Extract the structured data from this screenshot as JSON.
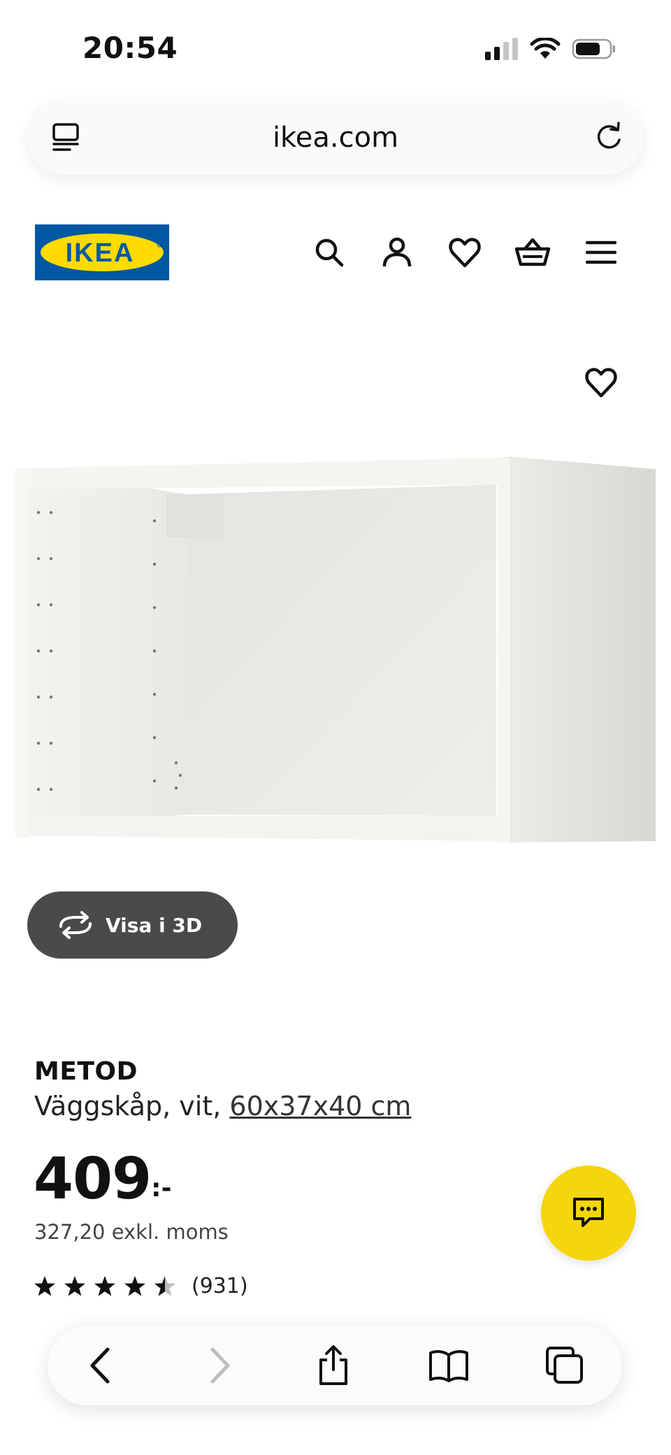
{
  "status_bar": {
    "time": "20:54",
    "icons": [
      "cellular-signal-icon",
      "wifi-icon",
      "battery-icon"
    ]
  },
  "browser": {
    "url": "ikea.com",
    "icons": [
      "reader-icon",
      "reload-icon"
    ]
  },
  "header": {
    "logo_text": "IKEA",
    "icons": [
      "search-icon",
      "account-icon",
      "heart-icon",
      "shopping-basket-icon",
      "menu-icon"
    ]
  },
  "product": {
    "view_3d_label": "Visa i 3D",
    "name": "METOD",
    "description_prefix": "Väggskåp, vit, ",
    "size": "60x37x40 cm",
    "price": "409",
    "price_suffix": ":-",
    "price_excl_vat": "327,20 exkl. moms",
    "rating_value": 4.5,
    "rating_max": 5,
    "review_count": "(931)"
  },
  "colors": {
    "ikea_blue": "#0058a3",
    "ikea_yellow": "#ffdb00",
    "chat_button": "#f5d50b",
    "view_3d_button": "#4a4a4a"
  },
  "bottom_toolbar": {
    "icons": [
      "back-icon",
      "forward-icon",
      "share-icon",
      "bookmarks-icon",
      "tabs-icon"
    ]
  }
}
